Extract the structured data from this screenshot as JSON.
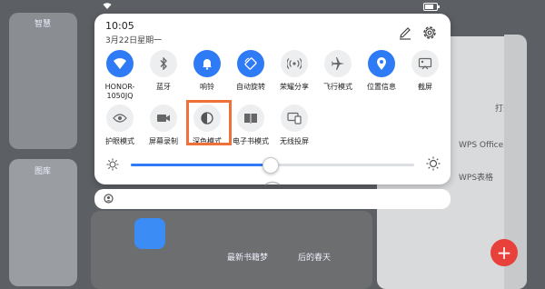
{
  "panel": {
    "time": "10:05",
    "date": "3月22日星期一"
  },
  "tiles_row1": [
    {
      "label": "HONOR-\n1050JQ",
      "icon": "wifi-icon",
      "on": true
    },
    {
      "label": "蓝牙",
      "icon": "bluetooth-icon",
      "on": false
    },
    {
      "label": "响铃",
      "icon": "bell-icon",
      "on": true
    },
    {
      "label": "自动旋转",
      "icon": "rotate-icon",
      "on": true
    },
    {
      "label": "荣耀分享",
      "icon": "share-icon",
      "on": false
    },
    {
      "label": "飞行模式",
      "icon": "airplane-icon",
      "on": false
    },
    {
      "label": "位置信息",
      "icon": "location-icon",
      "on": true
    },
    {
      "label": "截屏",
      "icon": "screenshot-icon",
      "on": false
    }
  ],
  "tiles_row2": [
    {
      "label": "护眼模式",
      "icon": "eye-icon",
      "on": false
    },
    {
      "label": "屏幕录制",
      "icon": "record-icon",
      "on": false
    },
    {
      "label": "深色模式",
      "icon": "dark-mode-icon",
      "on": false
    },
    {
      "label": "电子书模式",
      "icon": "ebook-icon",
      "on": false
    },
    {
      "label": "无线投屏",
      "icon": "cast-icon",
      "on": false
    }
  ],
  "brightness": {
    "level": 0.49
  },
  "colors": {
    "accent": "#2f7bf5",
    "highlight": "#f0703a"
  },
  "background": {
    "left_label_1": "智慧",
    "left_label_2": "图库",
    "right_label_1": "打开",
    "right_label_2": "WPS Office",
    "right_label_3": "WPS表格",
    "mid_label_1": "最新书籍梦",
    "mid_label_2": "后的春天"
  }
}
